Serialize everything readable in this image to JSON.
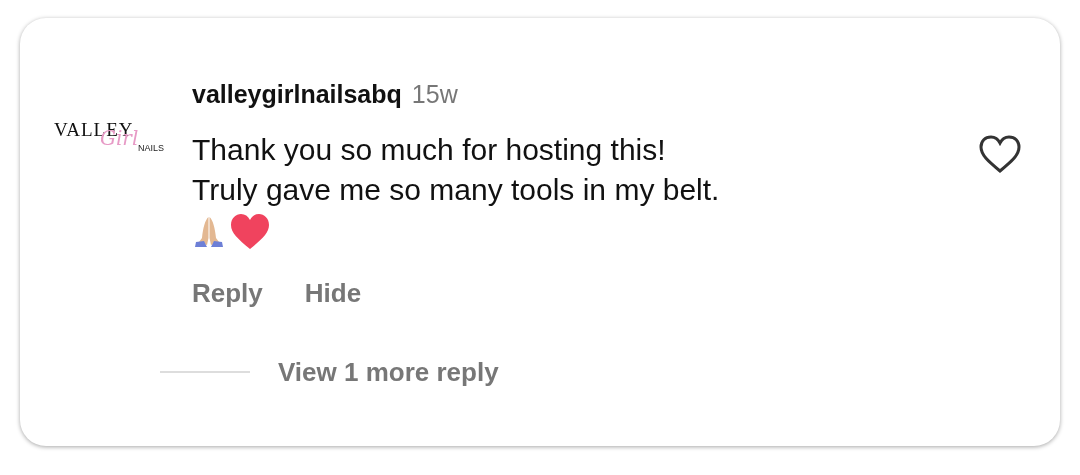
{
  "comment": {
    "avatar": {
      "logo_texts": [
        "VALLEY",
        "Girl",
        "NAILS"
      ]
    },
    "username": "valleygirlnailsabq",
    "time": "15w",
    "lines": [
      "Thank you so much for hosting this!",
      "Truly gave me so many tools in my belt."
    ],
    "liked": false,
    "actions": [
      "Reply",
      "Hide"
    ],
    "more_replies": "View 1 more reply"
  }
}
